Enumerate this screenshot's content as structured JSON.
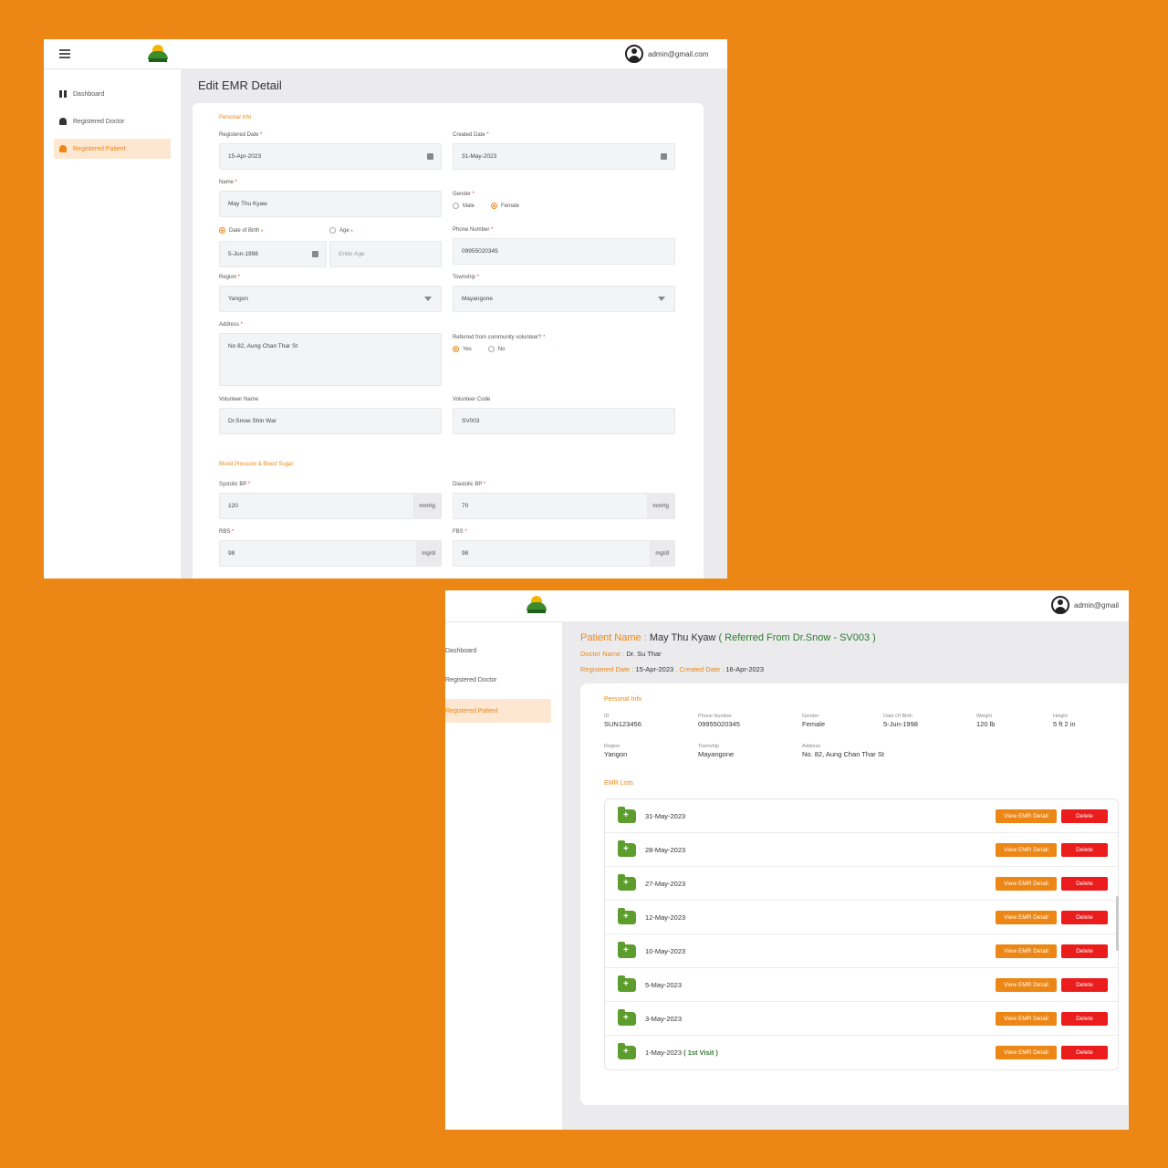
{
  "edit_window": {
    "user_email": "admin@gmail.com",
    "nav": [
      "Dashboard",
      "Registered Doctor",
      "Registered Patient"
    ],
    "page_title": "Edit EMR Detail",
    "personal_info_title": "Personal Info",
    "fields": {
      "registered_date": {
        "label": "Registered Date",
        "value": "15-Apr-2023"
      },
      "created_date": {
        "label": "Created Date",
        "value": "31-May-2023"
      },
      "name": {
        "label": "Name",
        "value": "May Thu Kyaw"
      },
      "gender": {
        "label": "Gender",
        "options": [
          "Male",
          "Female"
        ],
        "selected": "Female"
      },
      "dob": {
        "label": "Date of Birth",
        "value": "5-Jun-1998"
      },
      "age": {
        "label": "Age",
        "placeholder": "Enter Age"
      },
      "phone": {
        "label": "Phone Number",
        "value": "09955020345"
      },
      "region": {
        "label": "Region",
        "value": "Yangon"
      },
      "township": {
        "label": "Township",
        "value": "Mayangone"
      },
      "address": {
        "label": "Address",
        "value": "No 82, Aung Chan Thar St"
      },
      "referred": {
        "label": "Referred from community volunteer?",
        "options": [
          "Yes",
          "No"
        ],
        "selected": "Yes"
      },
      "volunteer_name": {
        "label": "Volunteer Name",
        "value": "Dr.Snow Shin War"
      },
      "volunteer_code": {
        "label": "Volunteer Code",
        "value": "SV003"
      }
    },
    "bp_section_title": "Blood Pressure & Blood Sugar",
    "bp_fields": {
      "systolic": {
        "label": "Systolic BP",
        "value": "120",
        "unit": "mmHg"
      },
      "diastolic": {
        "label": "Diastolic BP",
        "value": "70",
        "unit": "mmHg"
      },
      "rbs": {
        "label": "RBS",
        "value": "98",
        "unit": "mg/dl"
      },
      "fbs": {
        "label": "FBS",
        "value": "98",
        "unit": "mg/dl"
      }
    }
  },
  "detail_window": {
    "user_email": "admin@gmail",
    "nav": [
      "Dashboard",
      "Registered Doctor",
      "Registered Patient"
    ],
    "patient_name_label": "Patient Name :",
    "patient_name": "May Thu Kyaw",
    "referred_text": "( Referred From Dr.Snow - SV003 )",
    "doctor_label": "Doctor Name :",
    "doctor_name": "Dr. Su Thar",
    "registered_label": "Registered Date :",
    "registered_value": "15-Apr-2023",
    "created_label": "Created Date :",
    "created_value": "16-Apr-2023",
    "personal_info_title": "Personal Info",
    "info": [
      {
        "key": "ID",
        "value": "SUN123456"
      },
      {
        "key": "Phone Number",
        "value": "09955020345"
      },
      {
        "key": "Gender",
        "value": "Female"
      },
      {
        "key": "Date Of Birth",
        "value": "5-Jun-1998"
      },
      {
        "key": "Weight",
        "value": "120 lb"
      },
      {
        "key": "Height",
        "value": "5 ft 2 in"
      },
      {
        "key": "Region",
        "value": "Yangon"
      },
      {
        "key": "Township",
        "value": "Mayangone"
      },
      {
        "key": "Address",
        "value": "No. 82, Aung Chan Thar St"
      }
    ],
    "emr_title": "EMR Lists",
    "view_label": "View EMR Detail",
    "delete_label": "Delete",
    "emr_dates": [
      "31-May-2023",
      "28-May-2023",
      "27-May-2023",
      "12-May-2023",
      "10-May-2023",
      "5-May-2023",
      "3-May-2023",
      "1-May-2023"
    ],
    "first_visit_label": "( 1st Visit )"
  }
}
